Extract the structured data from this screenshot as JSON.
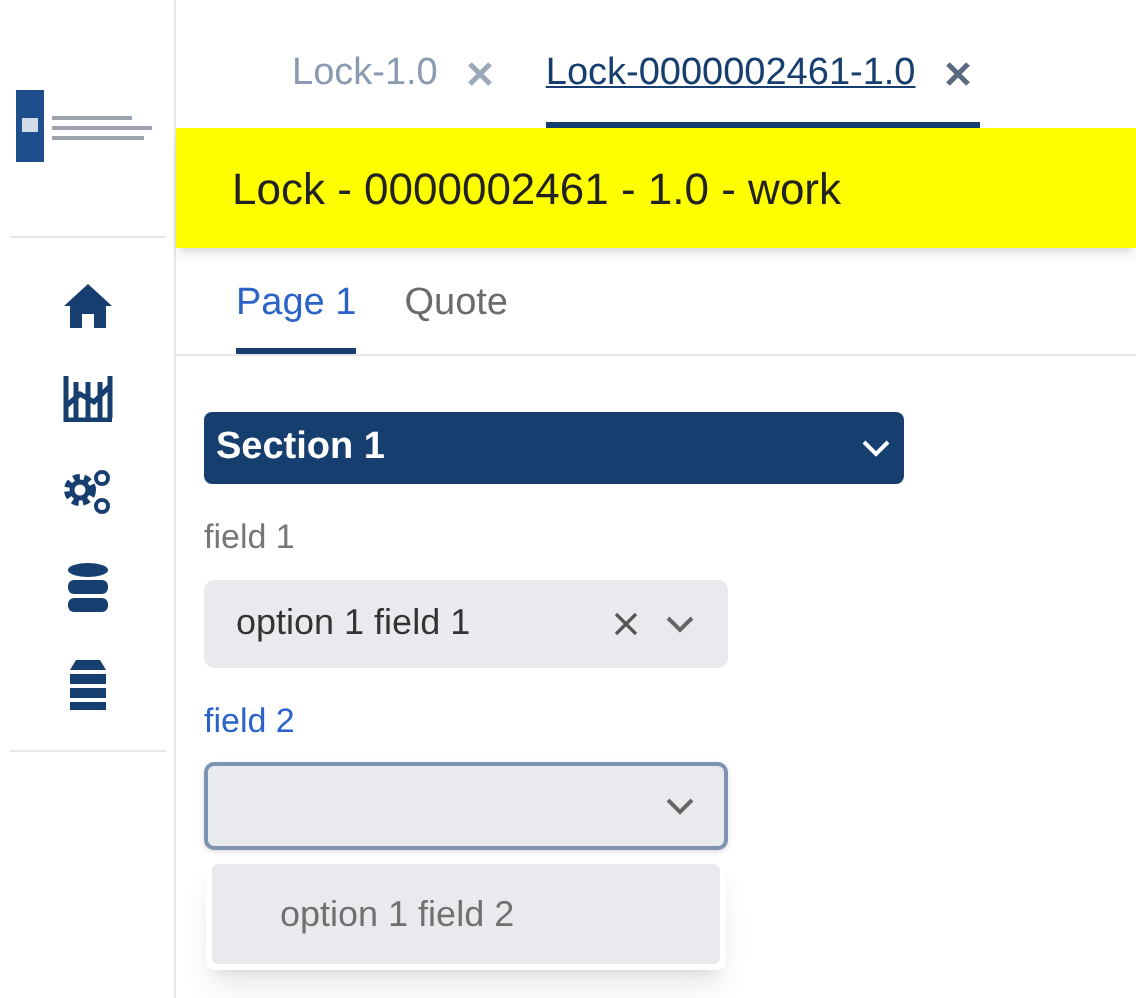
{
  "document_tabs": [
    {
      "label": "Lock-1.0",
      "selected": false
    },
    {
      "label": "Lock-0000002461-1.0",
      "selected": true
    }
  ],
  "title_banner": "Lock - 0000002461 - 1.0 - work",
  "page_tabs": [
    {
      "label": "Page 1",
      "selected": true
    },
    {
      "label": "Quote",
      "selected": false
    }
  ],
  "section": {
    "title": "Section 1",
    "expanded": true
  },
  "fields": [
    {
      "label": "field 1",
      "value": "option 1 field 1",
      "focused": false,
      "clearable": true
    },
    {
      "label": "field 2",
      "focused": true,
      "options": [
        "option 1 field 2"
      ]
    }
  ]
}
